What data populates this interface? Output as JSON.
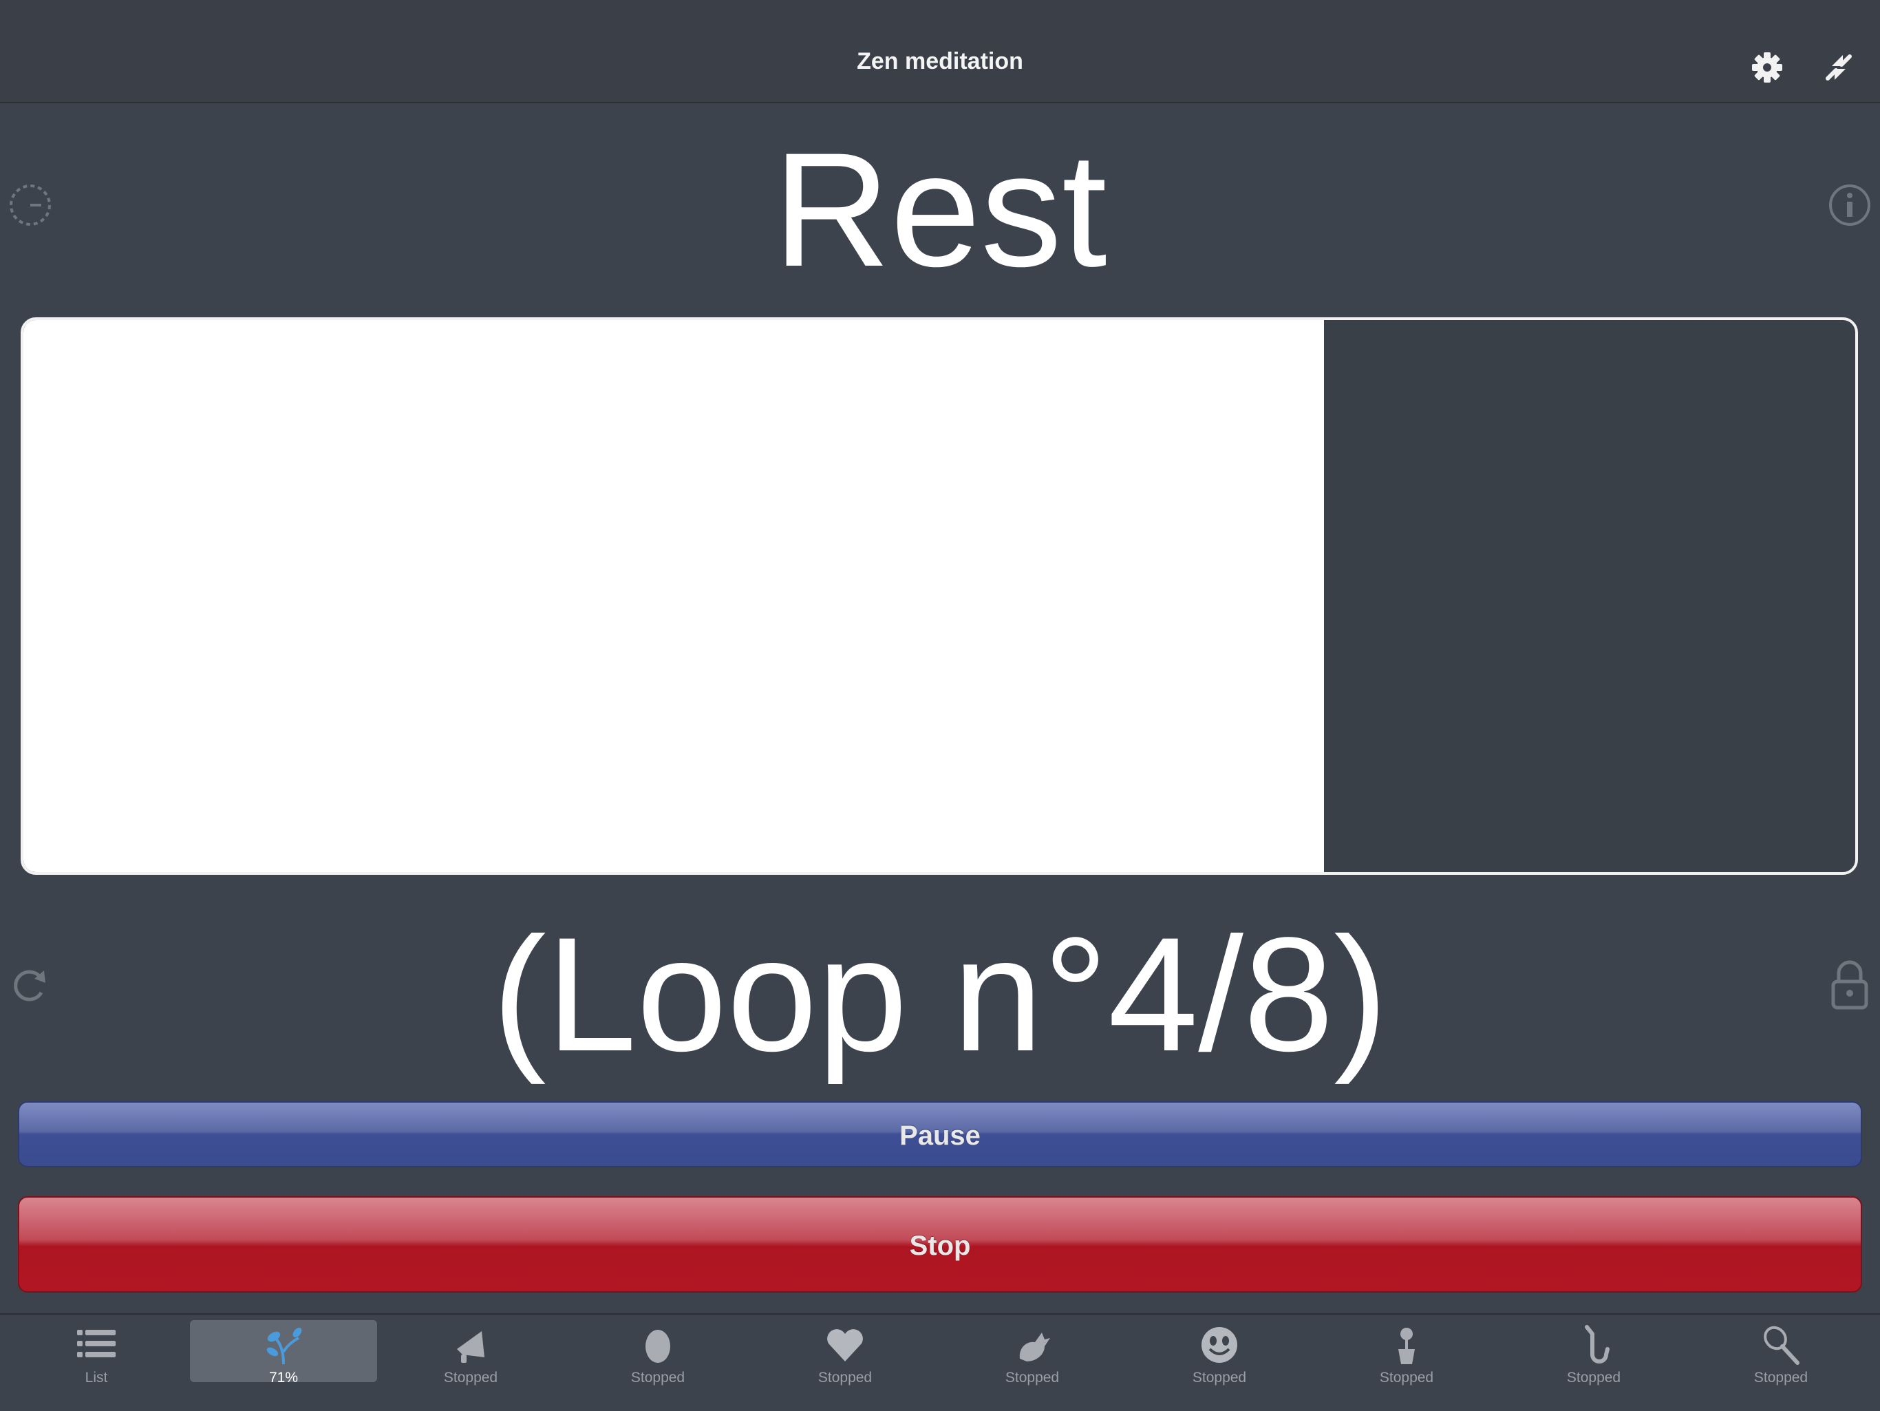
{
  "header": {
    "title": "Zen meditation"
  },
  "step": {
    "name": "Rest",
    "loop_text": "(Loop n°4/8)"
  },
  "progress": {
    "fraction": 0.71
  },
  "buttons": {
    "pause": "Pause",
    "stop": "Stop"
  },
  "tabs": [
    {
      "label": "List",
      "icon": "list-icon",
      "selected": false
    },
    {
      "label": "71%",
      "icon": "sprout-icon",
      "selected": true
    },
    {
      "label": "Stopped",
      "icon": "megaphone-icon",
      "selected": false
    },
    {
      "label": "Stopped",
      "icon": "egg-icon",
      "selected": false
    },
    {
      "label": "Stopped",
      "icon": "heart-icon",
      "selected": false
    },
    {
      "label": "Stopped",
      "icon": "dragon-icon",
      "selected": false
    },
    {
      "label": "Stopped",
      "icon": "smiley-icon",
      "selected": false
    },
    {
      "label": "Stopped",
      "icon": "flower-pot-icon",
      "selected": false
    },
    {
      "label": "Stopped",
      "icon": "saxophone-icon",
      "selected": false
    },
    {
      "label": "Stopped",
      "icon": "racket-icon",
      "selected": false
    }
  ],
  "colors": {
    "background": "#3d434c",
    "pause": "#3e4f95",
    "stop": "#ad1522",
    "selected_tab_icon": "#4a9bdc"
  }
}
